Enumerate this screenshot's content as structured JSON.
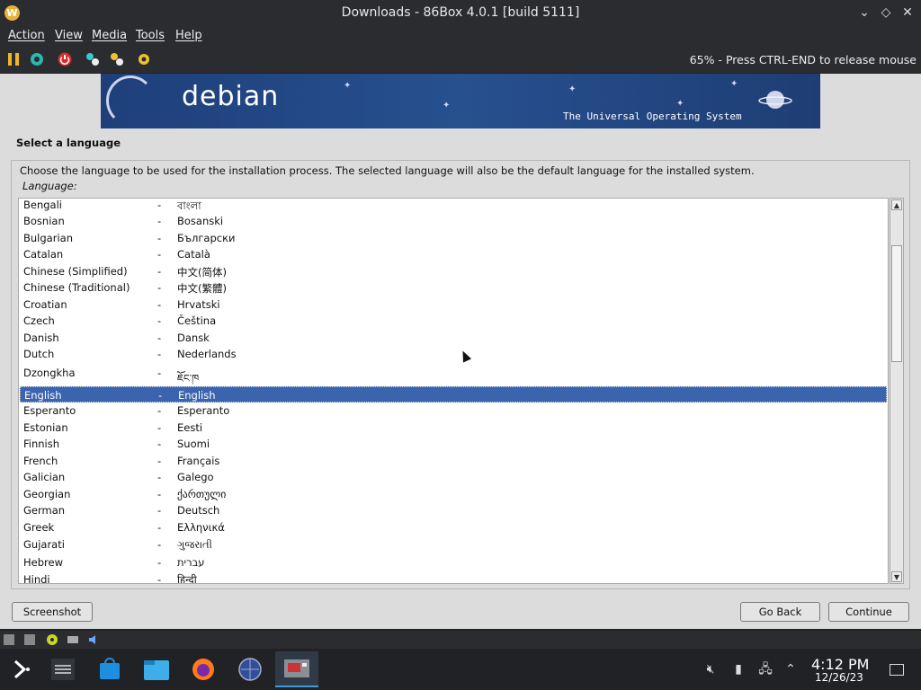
{
  "window": {
    "title": "Downloads - 86Box 4.0.1 [build 5111]"
  },
  "menu": [
    "Action",
    "View",
    "Media",
    "Tools",
    "Help"
  ],
  "toolbar": {
    "status": "65% - Press CTRL-END to release mouse"
  },
  "installer": {
    "banner_logo": "debian",
    "banner_tagline": "The Universal Operating System",
    "section_title": "Select a language",
    "description": "Choose the language to be used for the installation process. The selected language will also be the default language for the installed system.",
    "language_label": "Language:",
    "languages": [
      {
        "name": "Bengali",
        "native": "বাংলা"
      },
      {
        "name": "Bosnian",
        "native": "Bosanski"
      },
      {
        "name": "Bulgarian",
        "native": "Български"
      },
      {
        "name": "Catalan",
        "native": "Català"
      },
      {
        "name": "Chinese (Simplified)",
        "native": "中文(简体)"
      },
      {
        "name": "Chinese (Traditional)",
        "native": "中文(繁體)"
      },
      {
        "name": "Croatian",
        "native": "Hrvatski"
      },
      {
        "name": "Czech",
        "native": "Čeština"
      },
      {
        "name": "Danish",
        "native": "Dansk"
      },
      {
        "name": "Dutch",
        "native": "Nederlands"
      },
      {
        "name": "Dzongkha",
        "native": "ཇོང་ཁ"
      },
      {
        "name": "English",
        "native": "English"
      },
      {
        "name": "Esperanto",
        "native": "Esperanto"
      },
      {
        "name": "Estonian",
        "native": "Eesti"
      },
      {
        "name": "Finnish",
        "native": "Suomi"
      },
      {
        "name": "French",
        "native": "Français"
      },
      {
        "name": "Galician",
        "native": "Galego"
      },
      {
        "name": "Georgian",
        "native": "ქართული"
      },
      {
        "name": "German",
        "native": "Deutsch"
      },
      {
        "name": "Greek",
        "native": "Ελληνικά"
      },
      {
        "name": "Gujarati",
        "native": "ગુજરાતી"
      },
      {
        "name": "Hebrew",
        "native": "עברית"
      },
      {
        "name": "Hindi",
        "native": "हिन्दी"
      }
    ],
    "separator": "-",
    "selected": "English",
    "buttons": {
      "screenshot": "Screenshot",
      "go_back": "Go Back",
      "continue": "Continue"
    }
  },
  "taskbar": {
    "time": "4:12 PM",
    "date": "12/26/23"
  },
  "colors": {
    "selection": "#3b64ae",
    "chrome": "#2a2c30",
    "taskbar": "#202226",
    "active_task": "#3d9ce0"
  }
}
